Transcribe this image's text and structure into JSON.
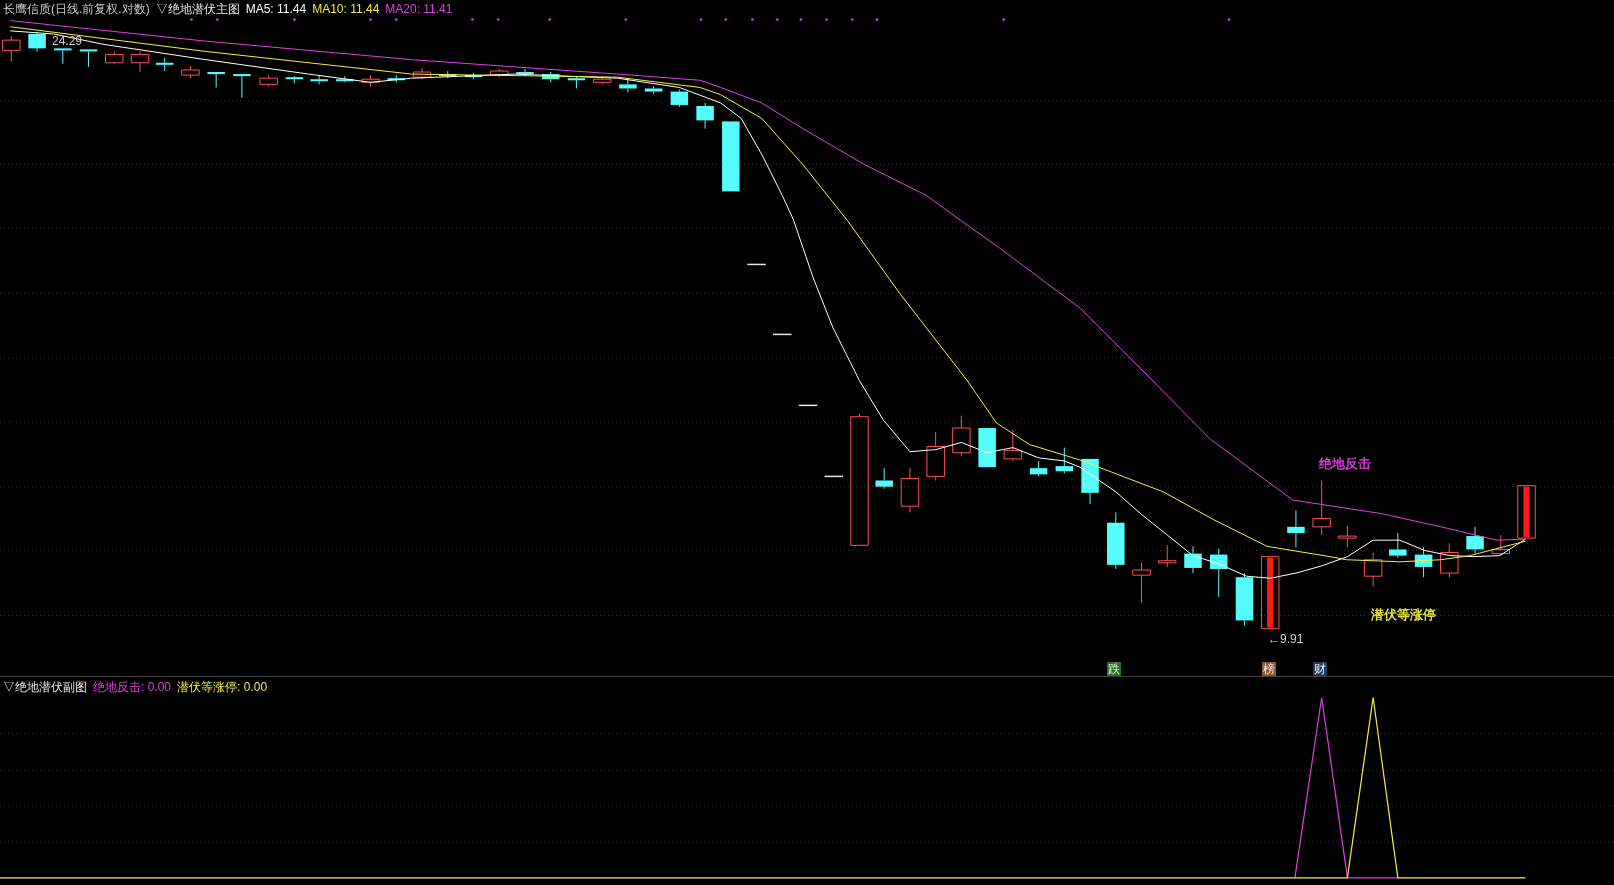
{
  "main_chart": {
    "security": "长鹰信质(日线.前复权.对数)",
    "indicator": "▽绝地潜伏主图",
    "legend": [
      {
        "label": "MA5: 11.44",
        "color": "#ffffff"
      },
      {
        "label": "MA10: 11.44",
        "color": "#f0f040"
      },
      {
        "label": "MA20: 11.41",
        "color": "#e040e0"
      }
    ],
    "high_label": "24.29",
    "low_label": "←9.91",
    "annotations": [
      {
        "text": "绝地反击",
        "color": "#e040e0"
      },
      {
        "text": "潜伏等涨停",
        "color": "#f0f040"
      }
    ],
    "tags": [
      {
        "text": "跌",
        "color": "#2a6e2a"
      },
      {
        "text": "榜",
        "color": "#8a5628"
      },
      {
        "text": "财",
        "color": "#1e3a60"
      }
    ]
  },
  "sub_chart": {
    "indicator": "▽绝地潜伏副图",
    "legend": [
      {
        "label": "绝地反击: 0.00",
        "color": "#e040e0"
      },
      {
        "label": "潜伏等涨停: 0.00",
        "color": "#f0f040"
      }
    ]
  }
}
